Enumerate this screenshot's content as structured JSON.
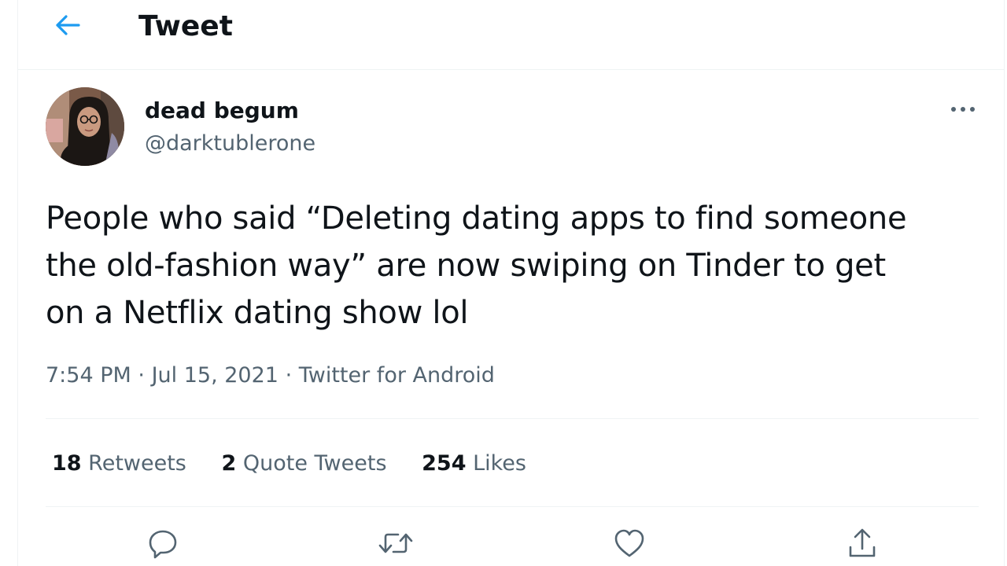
{
  "header": {
    "title": "Tweet",
    "back_icon": "arrow-left-icon",
    "accent_color": "#1d9bf0"
  },
  "author": {
    "name": "dead begum",
    "handle": "@darktublerone"
  },
  "tweet": {
    "text": "People who said “Deleting dating apps to find someone\nthe old-fashion way” are now swiping on Tinder to get\non a Netflix dating show lol",
    "time": "7:54 PM",
    "date": "Jul 15, 2021",
    "source": "Twitter for Android",
    "separator": "·"
  },
  "stats": {
    "retweets_count": "18",
    "retweets_label": "Retweets",
    "quotes_count": "2",
    "quotes_label": "Quote Tweets",
    "likes_count": "254",
    "likes_label": "Likes"
  },
  "actions": [
    "reply-icon",
    "retweet-icon",
    "like-icon",
    "share-icon"
  ],
  "colors": {
    "text_primary": "#0f1419",
    "text_secondary": "#536471",
    "border": "#eff3f4",
    "icon": "#536471"
  }
}
